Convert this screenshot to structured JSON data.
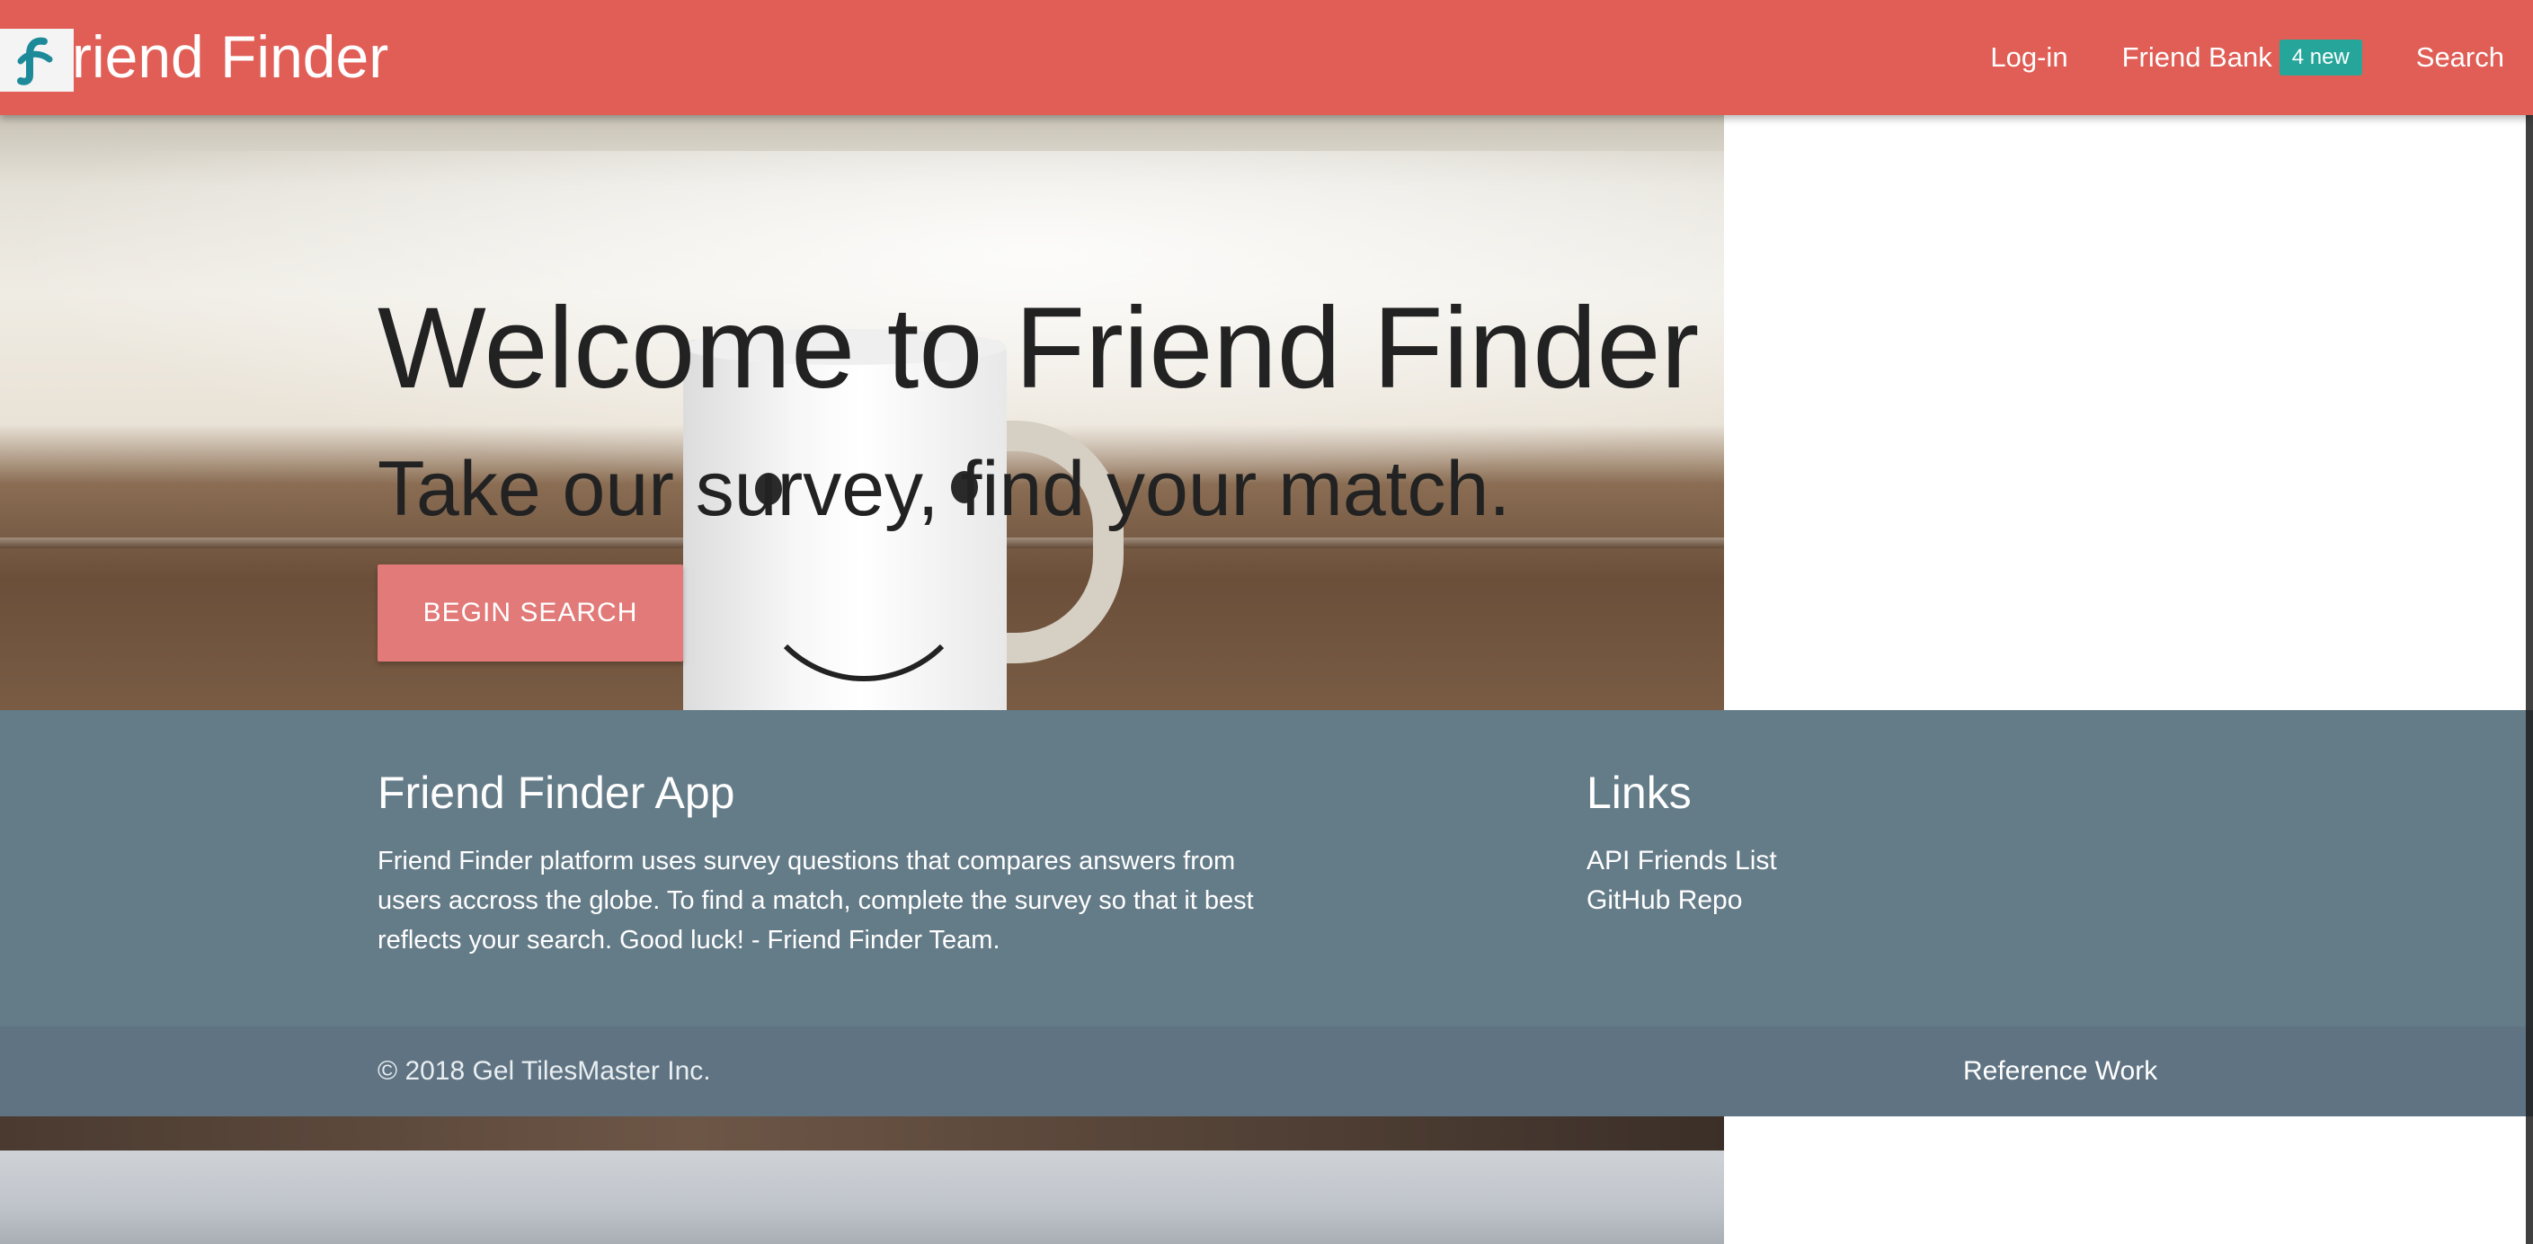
{
  "navbar": {
    "brand_text": "riend Finder",
    "logo_icon": "friend-finder-f-logo",
    "links": {
      "login": "Log-in",
      "friend_bank": "Friend Bank",
      "friend_bank_badge": "4 new",
      "search": "Search"
    }
  },
  "hero": {
    "title": "Welcome to Friend Finder",
    "subtitle": "Take our survey, find your match.",
    "button_label": "BEGIN SEARCH"
  },
  "footer": {
    "about": {
      "heading": "Friend Finder App",
      "description": "Friend Finder platform uses survey questions that compares answers from users accross the globe. To find a match, complete the survey so that it best reflects your search. Good luck! - Friend Finder Team."
    },
    "links": {
      "heading": "Links",
      "items": [
        "API Friends List",
        "GitHub Repo"
      ]
    }
  },
  "copyright": {
    "text": "© 2018 Gel TilesMaster Inc.",
    "reference_link": "Reference Work"
  },
  "colors": {
    "navbar": "#e05e56",
    "badge": "#26a69a",
    "button": "#e17a78",
    "footer": "#647b88",
    "copyright_bar": "#5f7382"
  }
}
